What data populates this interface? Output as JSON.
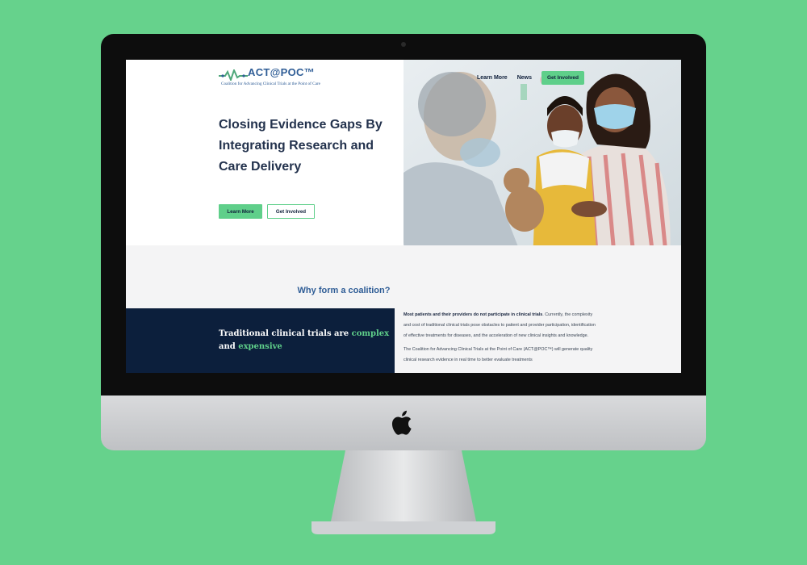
{
  "site": {
    "logo_title": "ACT@POC™",
    "logo_tagline": "Coalition for Advancing Clinical Trials at the Point of Care"
  },
  "nav": {
    "learn_more": "Learn More",
    "news": "News",
    "get_involved": "Get Involved"
  },
  "hero": {
    "title": "Closing Evidence Gaps By Integrating Research and Care Delivery",
    "primary_button": "Learn More",
    "secondary_button": "Get Involved"
  },
  "why": {
    "heading": "Why form a coalition?",
    "panel_text_1": "Traditional clinical trials are ",
    "panel_accent_1": "complex",
    "panel_text_2": " and ",
    "panel_accent_2": "expensive",
    "para1_bold": "Most patients and their providers do not participate in clinical trials",
    "para1_rest": ". Currently, the complexity and cost of traditional clinical trials pose obstacles to patient and provider participation, identification of effective treatments for diseases, and the acceleration of new clinical insights and knowledge.",
    "para2": "The Coalition for Advancing Clinical Trials at the Point of Care (ACT@POC™) will generate quality clinical research evidence in real time to better evaluate treatments"
  },
  "colors": {
    "background": "#66d28c",
    "accent": "#5fcf8a",
    "navy": "#0c1f3c",
    "brand_blue": "#2f5d96"
  },
  "icons": [
    "apple-logo-icon",
    "heartbeat-wave-icon"
  ]
}
